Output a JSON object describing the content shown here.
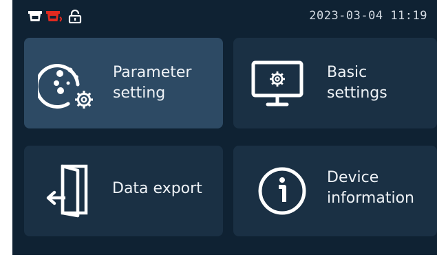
{
  "status_bar": {
    "datetime": "2023-03-04  11:19",
    "icons": [
      "tray-icon",
      "tray-heating-icon",
      "unlock-icon"
    ]
  },
  "menu": {
    "items": [
      {
        "label": "Parameter\nsetting",
        "icon": "palette-gear-icon",
        "selected": true
      },
      {
        "label": "Basic\nsettings",
        "icon": "monitor-gear-icon",
        "selected": false
      },
      {
        "label": "Data export",
        "icon": "door-exit-icon",
        "selected": false
      },
      {
        "label": "Device\ninformation",
        "icon": "info-icon",
        "selected": false
      }
    ]
  },
  "colors": {
    "background": "#0f2233",
    "tile": "#1a3044",
    "tile_selected": "#2d4a64",
    "status_red": "#e02a20",
    "icon_white": "#ffffff"
  }
}
